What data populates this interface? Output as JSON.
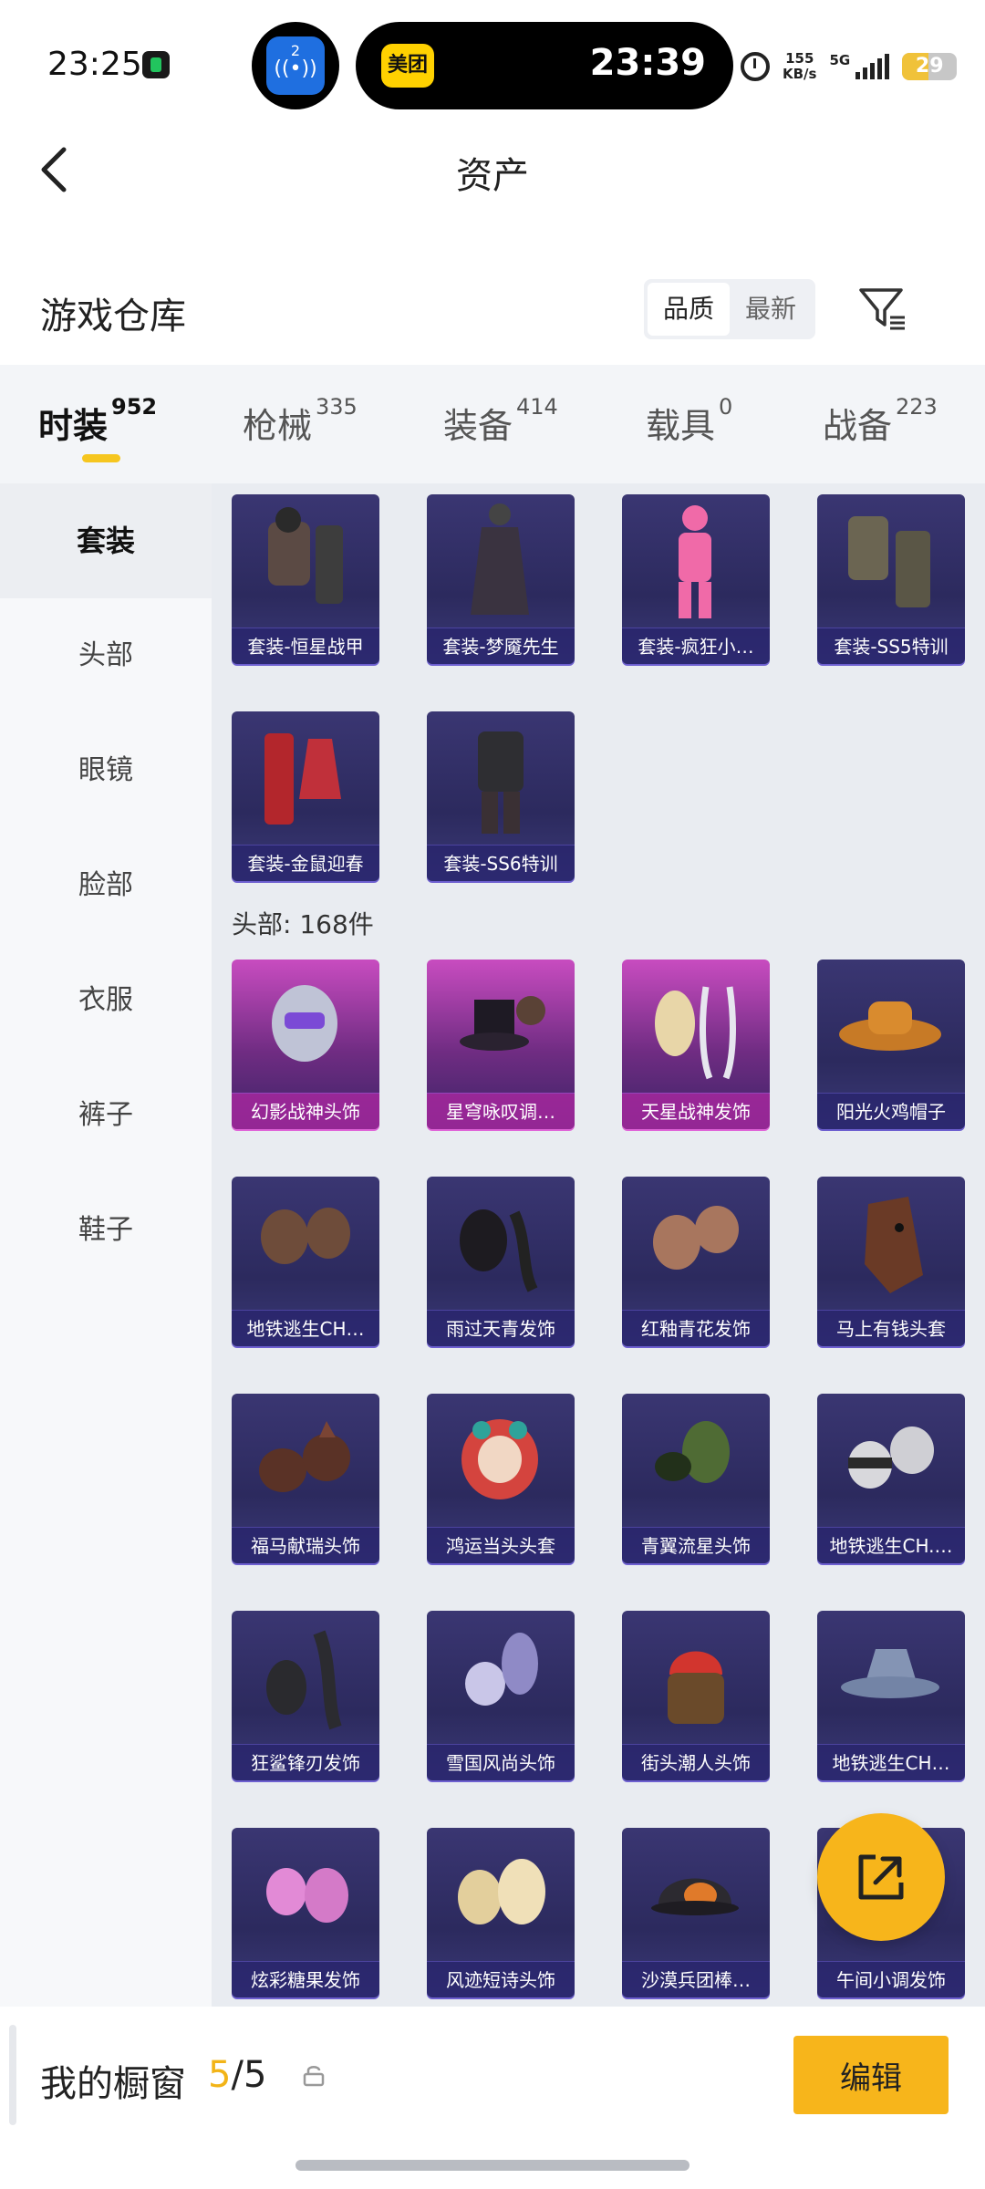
{
  "status_bar": {
    "time": "23:25",
    "island_badge": "2",
    "island_app": "美团",
    "island_time": "23:39",
    "net_speed_value": "155",
    "net_speed_unit": "KB/s",
    "network_type": "5G",
    "battery_level": "29"
  },
  "header": {
    "title": "资产"
  },
  "warehouse": {
    "title": "游戏仓库",
    "sort_options": [
      "品质",
      "最新"
    ],
    "active_sort": "品质"
  },
  "tabs": [
    {
      "label": "时装",
      "count": "952",
      "active": true
    },
    {
      "label": "枪械",
      "count": "335",
      "active": false
    },
    {
      "label": "装备",
      "count": "414",
      "active": false
    },
    {
      "label": "载具",
      "count": "0",
      "active": false
    },
    {
      "label": "战备",
      "count": "223",
      "active": false
    }
  ],
  "sidebar": {
    "items": [
      "套装",
      "头部",
      "眼镜",
      "脸部",
      "衣服",
      "裤子",
      "鞋子"
    ],
    "active": "套装"
  },
  "suits": [
    {
      "label": "套装-恒星战甲",
      "icon": "dark-jacket-outfit"
    },
    {
      "label": "套装-梦魇先生",
      "icon": "long-coat-outfit"
    },
    {
      "label": "套装-疯狂小…",
      "icon": "pink-bunny-outfit"
    },
    {
      "label": "套装-SS5特训",
      "icon": "military-outfit"
    },
    {
      "label": "套装-金鼠迎春",
      "icon": "red-dress-outfit"
    },
    {
      "label": "套装-SS6特训",
      "icon": "leather-outfit"
    }
  ],
  "head_section": {
    "title": "头部: 168件"
  },
  "head_items": [
    {
      "label": "幻影战神头饰",
      "rarity": "legendary",
      "icon": "helmet-icon"
    },
    {
      "label": "星穹咏叹调…",
      "rarity": "legendary",
      "icon": "top-hat-icon"
    },
    {
      "label": "天星战神发饰",
      "rarity": "legendary",
      "icon": "hair-icon"
    },
    {
      "label": "阳光火鸡帽子",
      "rarity": "epic",
      "icon": "cowboy-hat-icon"
    },
    {
      "label": "地铁逃生CH…",
      "rarity": "epic",
      "icon": "hair-icon"
    },
    {
      "label": "雨过天青发饰",
      "rarity": "epic",
      "icon": "hair-icon"
    },
    {
      "label": "红釉青花发饰",
      "rarity": "epic",
      "icon": "hair-icon"
    },
    {
      "label": "马上有钱头套",
      "rarity": "epic",
      "icon": "horse-mask-icon"
    },
    {
      "label": "福马献瑞头饰",
      "rarity": "epic",
      "icon": "horse-ears-icon"
    },
    {
      "label": "鸿运当头头套",
      "rarity": "epic",
      "icon": "lion-mask-icon"
    },
    {
      "label": "青翼流星头饰",
      "rarity": "epic",
      "icon": "hair-icon"
    },
    {
      "label": "地铁逃生CH.…",
      "rarity": "epic",
      "icon": "beanie-icon"
    },
    {
      "label": "狂鲨锋刃发饰",
      "rarity": "epic",
      "icon": "hair-icon"
    },
    {
      "label": "雪国风尚头饰",
      "rarity": "epic",
      "icon": "hair-icon"
    },
    {
      "label": "街头潮人头饰",
      "rarity": "epic",
      "icon": "red-beanie-icon"
    },
    {
      "label": "地铁逃生CH…",
      "rarity": "epic",
      "icon": "bucket-hat-icon"
    },
    {
      "label": "炫彩糖果发饰",
      "rarity": "epic",
      "icon": "pink-hair-icon"
    },
    {
      "label": "风迹短诗头饰",
      "rarity": "epic",
      "icon": "hair-icon"
    },
    {
      "label": "沙漠兵团棒…",
      "rarity": "epic",
      "icon": "cap-icon"
    },
    {
      "label": "午间小调发饰",
      "rarity": "epic",
      "icon": "hair-icon"
    }
  ],
  "showcase": {
    "label": "我的橱窗",
    "used": "5",
    "separator": "/",
    "total": "5",
    "edit_label": "编辑"
  },
  "colors": {
    "accent": "#f7b51b",
    "tab_underline": "#f6c61f",
    "legendary_card": "#c84cc0",
    "epic_card": "#3a3672"
  }
}
